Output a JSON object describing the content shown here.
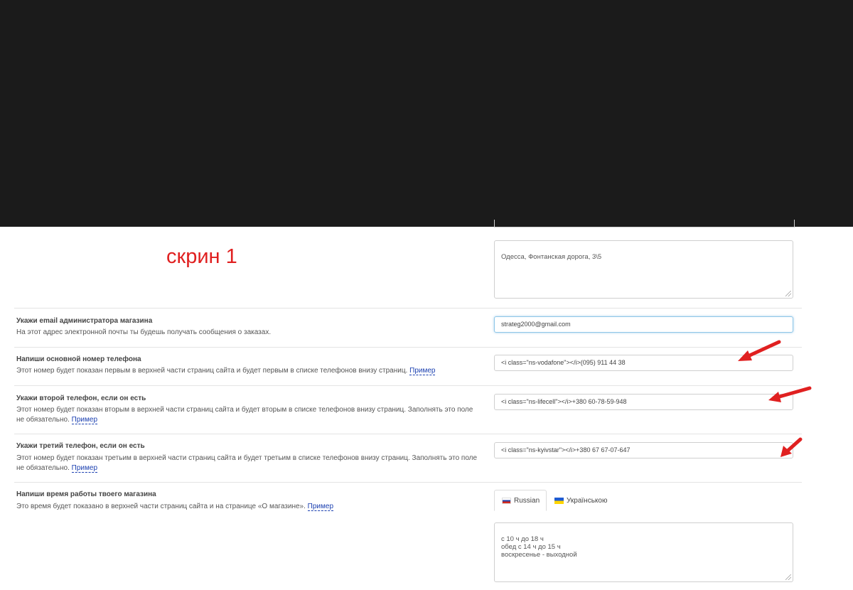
{
  "annotation": {
    "label": "скрин 1"
  },
  "address_field": {
    "value": "Одесса, Фонтанская дорога, 3\\5"
  },
  "email_row": {
    "title": "Укажи email администратора магазина",
    "description": "На этот адрес электронной почты ты будешь получать сообщения о заказах.",
    "value": "strateg2000@gmail.com"
  },
  "phone1_row": {
    "title": "Напиши основной номер телефона",
    "description": "Этот номер будет показан первым в верхней части страниц сайта и будет первым в списке телефонов внизу страниц.",
    "example_link": "Пример",
    "value": "<i class=\"ns-vodafone\"></i>(095) 911 44 38"
  },
  "phone2_row": {
    "title": "Укажи второй телефон, если он есть",
    "description": "Этот номер будет показан вторым в верхней части страниц сайта и будет вторым в списке телефонов внизу страниц. Заполнять это поле не обязательно.",
    "example_link": "Пример",
    "value": "<i class=\"ns-lifecell\"></i>+380 60-78-59-948"
  },
  "phone3_row": {
    "title": "Укажи третий телефон, если он есть",
    "description": "Этот номер будет показан третьим в верхней части страниц сайта и будет третьим в списке телефонов внизу страниц. Заполнять это поле не обязательно.",
    "example_link": "Пример",
    "value": "<i class=\"ns-kyivstar\"></i>+380 67 67-07-647"
  },
  "hours_row": {
    "title": "Напиши время работы твоего магазина",
    "description": "Это время будет показано в верхней части страниц сайта и на странице «О магазине».",
    "example_link": "Пример",
    "tabs": [
      {
        "label": "Russian",
        "flag": "flag-ru"
      },
      {
        "label": "Українською",
        "flag": "flag-ua"
      }
    ],
    "value": "с 10 ч до 18 ч\nобед с 14 ч до 15 ч\nвоскресенье - выходной"
  },
  "colors": {
    "annotation_red": "#e02020",
    "link_blue": "#1a3fb0",
    "overlay": "#1b1b1b"
  }
}
